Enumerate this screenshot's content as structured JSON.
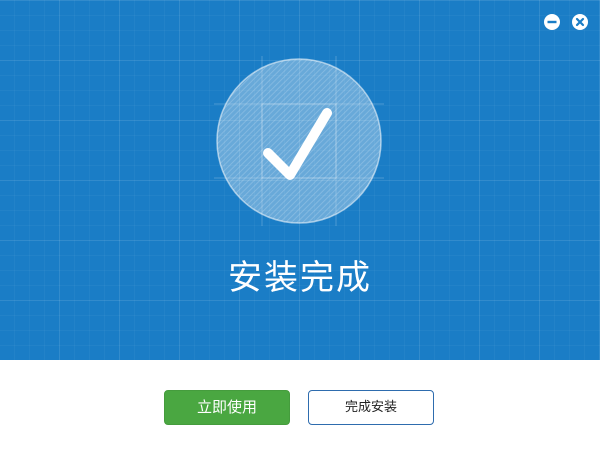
{
  "window": {
    "controls": {
      "minimize_icon": "minus-circle-icon",
      "close_icon": "x-circle-icon"
    }
  },
  "hero": {
    "status_icon": "checkmark-icon",
    "title": "安装完成"
  },
  "footer": {
    "primary_button_label": "立即使用",
    "secondary_button_label": "完成安装"
  },
  "colors": {
    "hero_background": "#1a7dc6",
    "primary_button": "#4aa741",
    "secondary_button_border": "#2e6cae",
    "footer_background": "#ffffff"
  }
}
